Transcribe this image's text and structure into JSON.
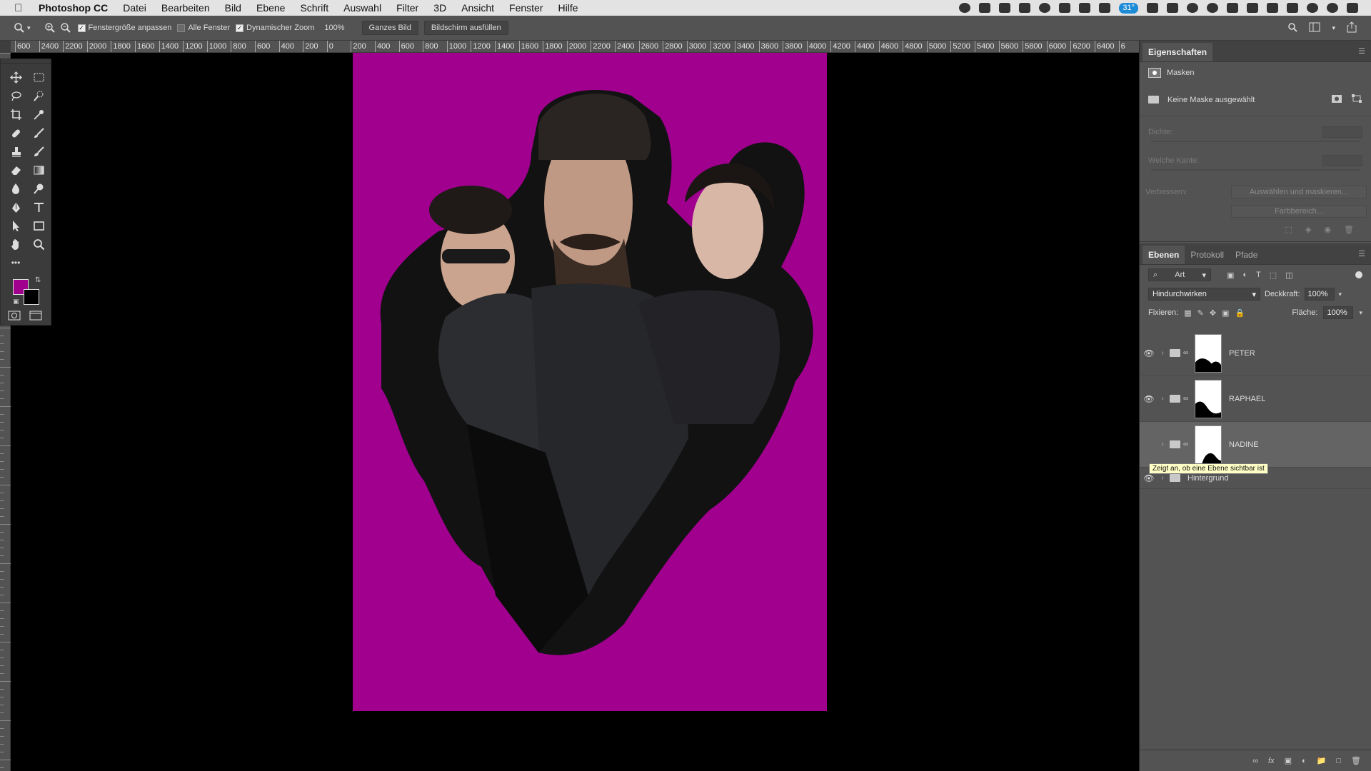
{
  "menubar": {
    "app": "Photoshop CC",
    "items": [
      "Datei",
      "Bearbeiten",
      "Bild",
      "Ebene",
      "Schrift",
      "Auswahl",
      "Filter",
      "3D",
      "Ansicht",
      "Fenster",
      "Hilfe"
    ],
    "battery_badge": "31°"
  },
  "options": {
    "fit_window_label": "Fenstergröße anpassen",
    "all_windows_label": "Alle Fenster",
    "dynamic_zoom_label": "Dynamischer Zoom",
    "zoom_value": "100%",
    "whole_image_label": "Ganzes Bild",
    "fill_screen_label": "Bildschirm ausfüllen"
  },
  "ruler_h": [
    "600",
    "2400",
    "2200",
    "2000",
    "1800",
    "1600",
    "1400",
    "1200",
    "1000",
    "800",
    "600",
    "400",
    "200",
    "0",
    "200",
    "400",
    "600",
    "800",
    "1000",
    "1200",
    "1400",
    "1600",
    "1800",
    "2000",
    "2200",
    "2400",
    "2600",
    "2800",
    "3000",
    "3200",
    "3400",
    "3600",
    "3800",
    "4000",
    "4200",
    "4400",
    "4600",
    "4800",
    "5000",
    "5200",
    "5400",
    "5600",
    "5800",
    "6000",
    "6200",
    "6400",
    "6"
  ],
  "colors": {
    "foreground": "#a1008f",
    "background": "#000000",
    "document_bg": "#a1008f"
  },
  "properties": {
    "tab": "Eigenschaften",
    "masks_title": "Masken",
    "no_mask": "Keine Maske ausgewählt",
    "density_label": "Dichte:",
    "feather_label": "Weiche Kante:",
    "refine_label": "Verbessern:",
    "select_mask_button": "Auswählen und maskieren...",
    "color_range_button": "Farbbereich..."
  },
  "layers_panel": {
    "tabs": [
      "Ebenen",
      "Protokoll",
      "Pfade"
    ],
    "filter_kind": "Art",
    "blend_mode": "Hindurchwirken",
    "opacity_label": "Deckkraft:",
    "opacity_value": "100%",
    "lock_label": "Fixieren:",
    "fill_label": "Fläche:",
    "fill_value": "100%",
    "layers": [
      {
        "name": "PETER",
        "visible": true,
        "selected": false
      },
      {
        "name": "RAPHAEL",
        "visible": true,
        "selected": false
      },
      {
        "name": "NADINE",
        "visible": false,
        "selected": true
      },
      {
        "name": "Hintergrund",
        "visible": true,
        "selected": false
      }
    ],
    "tooltip": "Zeigt an, ob eine Ebene sichtbar ist"
  }
}
